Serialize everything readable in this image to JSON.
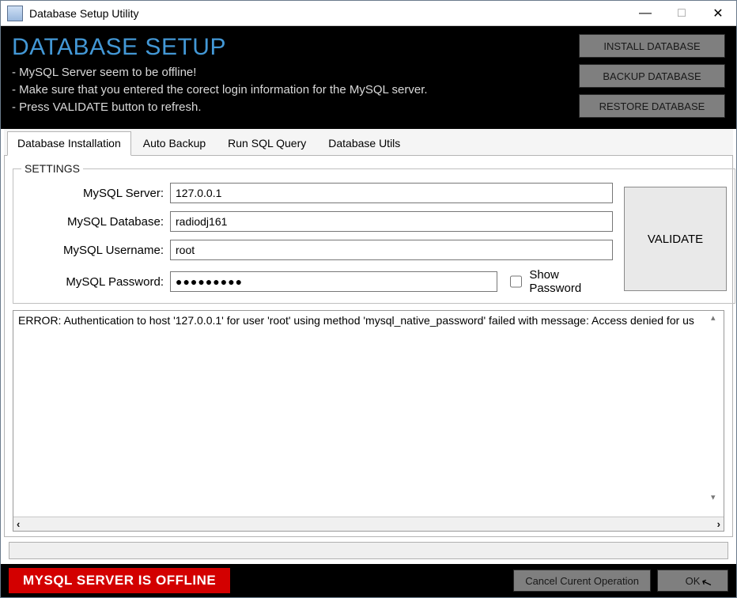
{
  "window": {
    "title": "Database Setup Utility"
  },
  "header": {
    "title": "DATABASE SETUP",
    "lines": [
      "- MySQL Server seem to be offline!",
      "- Make sure that you entered the corect login information for the MySQL server.",
      "- Press VALIDATE button to refresh."
    ],
    "buttons": {
      "install": "INSTALL DATABASE",
      "backup": "BACKUP DATABASE",
      "restore": "RESTORE DATABASE"
    }
  },
  "tabs": {
    "items": [
      {
        "label": "Database Installation",
        "active": true
      },
      {
        "label": "Auto Backup",
        "active": false
      },
      {
        "label": "Run SQL Query",
        "active": false
      },
      {
        "label": "Database Utils",
        "active": false
      }
    ]
  },
  "settings": {
    "legend": "SETTINGS",
    "labels": {
      "server": "MySQL Server:",
      "database": "MySQL Database:",
      "username": "MySQL Username:",
      "password": "MySQL Password:",
      "show_password": "Show Password"
    },
    "values": {
      "server": "127.0.0.1",
      "database": "radiodj161",
      "username": "root",
      "password_masked": "●●●●●●●●●"
    },
    "validate_label": "VALIDATE"
  },
  "log": {
    "text": "ERROR: Authentication to host '127.0.0.1' for user 'root' using method 'mysql_native_password' failed with message: Access denied for us"
  },
  "footer": {
    "status": "MYSQL SERVER IS OFFLINE",
    "cancel": "Cancel Curent Operation",
    "ok": "OK"
  }
}
